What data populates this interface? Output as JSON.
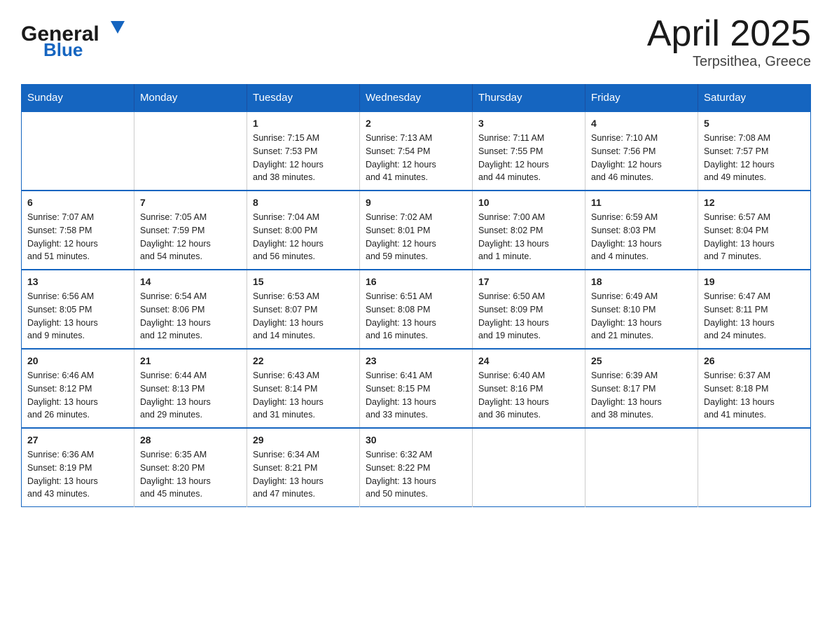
{
  "header": {
    "logo_general": "General",
    "logo_blue": "Blue",
    "title": "April 2025",
    "subtitle": "Terpsithea, Greece"
  },
  "calendar": {
    "weekdays": [
      "Sunday",
      "Monday",
      "Tuesday",
      "Wednesday",
      "Thursday",
      "Friday",
      "Saturday"
    ],
    "weeks": [
      [
        {
          "day": "",
          "info": ""
        },
        {
          "day": "",
          "info": ""
        },
        {
          "day": "1",
          "info": "Sunrise: 7:15 AM\nSunset: 7:53 PM\nDaylight: 12 hours\nand 38 minutes."
        },
        {
          "day": "2",
          "info": "Sunrise: 7:13 AM\nSunset: 7:54 PM\nDaylight: 12 hours\nand 41 minutes."
        },
        {
          "day": "3",
          "info": "Sunrise: 7:11 AM\nSunset: 7:55 PM\nDaylight: 12 hours\nand 44 minutes."
        },
        {
          "day": "4",
          "info": "Sunrise: 7:10 AM\nSunset: 7:56 PM\nDaylight: 12 hours\nand 46 minutes."
        },
        {
          "day": "5",
          "info": "Sunrise: 7:08 AM\nSunset: 7:57 PM\nDaylight: 12 hours\nand 49 minutes."
        }
      ],
      [
        {
          "day": "6",
          "info": "Sunrise: 7:07 AM\nSunset: 7:58 PM\nDaylight: 12 hours\nand 51 minutes."
        },
        {
          "day": "7",
          "info": "Sunrise: 7:05 AM\nSunset: 7:59 PM\nDaylight: 12 hours\nand 54 minutes."
        },
        {
          "day": "8",
          "info": "Sunrise: 7:04 AM\nSunset: 8:00 PM\nDaylight: 12 hours\nand 56 minutes."
        },
        {
          "day": "9",
          "info": "Sunrise: 7:02 AM\nSunset: 8:01 PM\nDaylight: 12 hours\nand 59 minutes."
        },
        {
          "day": "10",
          "info": "Sunrise: 7:00 AM\nSunset: 8:02 PM\nDaylight: 13 hours\nand 1 minute."
        },
        {
          "day": "11",
          "info": "Sunrise: 6:59 AM\nSunset: 8:03 PM\nDaylight: 13 hours\nand 4 minutes."
        },
        {
          "day": "12",
          "info": "Sunrise: 6:57 AM\nSunset: 8:04 PM\nDaylight: 13 hours\nand 7 minutes."
        }
      ],
      [
        {
          "day": "13",
          "info": "Sunrise: 6:56 AM\nSunset: 8:05 PM\nDaylight: 13 hours\nand 9 minutes."
        },
        {
          "day": "14",
          "info": "Sunrise: 6:54 AM\nSunset: 8:06 PM\nDaylight: 13 hours\nand 12 minutes."
        },
        {
          "day": "15",
          "info": "Sunrise: 6:53 AM\nSunset: 8:07 PM\nDaylight: 13 hours\nand 14 minutes."
        },
        {
          "day": "16",
          "info": "Sunrise: 6:51 AM\nSunset: 8:08 PM\nDaylight: 13 hours\nand 16 minutes."
        },
        {
          "day": "17",
          "info": "Sunrise: 6:50 AM\nSunset: 8:09 PM\nDaylight: 13 hours\nand 19 minutes."
        },
        {
          "day": "18",
          "info": "Sunrise: 6:49 AM\nSunset: 8:10 PM\nDaylight: 13 hours\nand 21 minutes."
        },
        {
          "day": "19",
          "info": "Sunrise: 6:47 AM\nSunset: 8:11 PM\nDaylight: 13 hours\nand 24 minutes."
        }
      ],
      [
        {
          "day": "20",
          "info": "Sunrise: 6:46 AM\nSunset: 8:12 PM\nDaylight: 13 hours\nand 26 minutes."
        },
        {
          "day": "21",
          "info": "Sunrise: 6:44 AM\nSunset: 8:13 PM\nDaylight: 13 hours\nand 29 minutes."
        },
        {
          "day": "22",
          "info": "Sunrise: 6:43 AM\nSunset: 8:14 PM\nDaylight: 13 hours\nand 31 minutes."
        },
        {
          "day": "23",
          "info": "Sunrise: 6:41 AM\nSunset: 8:15 PM\nDaylight: 13 hours\nand 33 minutes."
        },
        {
          "day": "24",
          "info": "Sunrise: 6:40 AM\nSunset: 8:16 PM\nDaylight: 13 hours\nand 36 minutes."
        },
        {
          "day": "25",
          "info": "Sunrise: 6:39 AM\nSunset: 8:17 PM\nDaylight: 13 hours\nand 38 minutes."
        },
        {
          "day": "26",
          "info": "Sunrise: 6:37 AM\nSunset: 8:18 PM\nDaylight: 13 hours\nand 41 minutes."
        }
      ],
      [
        {
          "day": "27",
          "info": "Sunrise: 6:36 AM\nSunset: 8:19 PM\nDaylight: 13 hours\nand 43 minutes."
        },
        {
          "day": "28",
          "info": "Sunrise: 6:35 AM\nSunset: 8:20 PM\nDaylight: 13 hours\nand 45 minutes."
        },
        {
          "day": "29",
          "info": "Sunrise: 6:34 AM\nSunset: 8:21 PM\nDaylight: 13 hours\nand 47 minutes."
        },
        {
          "day": "30",
          "info": "Sunrise: 6:32 AM\nSunset: 8:22 PM\nDaylight: 13 hours\nand 50 minutes."
        },
        {
          "day": "",
          "info": ""
        },
        {
          "day": "",
          "info": ""
        },
        {
          "day": "",
          "info": ""
        }
      ]
    ]
  }
}
